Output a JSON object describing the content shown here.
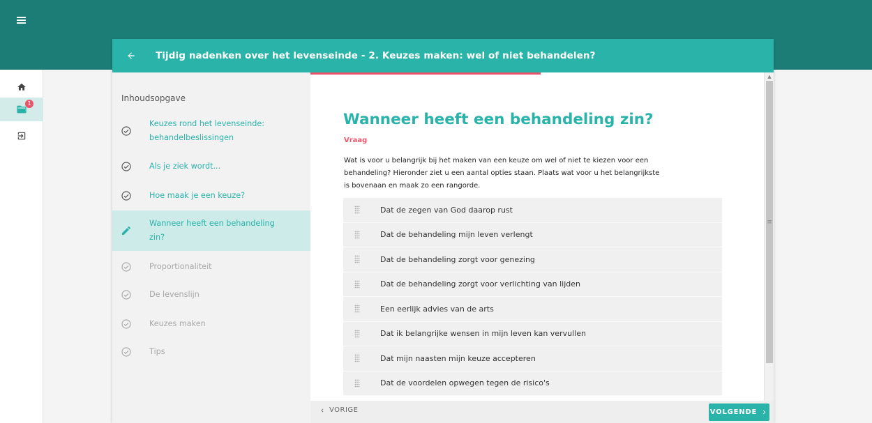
{
  "header": {
    "title": "Tijdig nadenken over het levenseinde - 2. Keuzes maken: wel of niet behandelen?"
  },
  "rail": {
    "badge_count": "1"
  },
  "toc": {
    "heading": "Inhoudsopgave",
    "items": [
      {
        "label": "Keuzes rond het levenseinde: behandelbeslissingen",
        "state": "done"
      },
      {
        "label": "Als je ziek wordt...",
        "state": "done"
      },
      {
        "label": "Hoe maak je een keuze?",
        "state": "done"
      },
      {
        "label": "Wanneer heeft een behandeling zin?",
        "state": "active"
      },
      {
        "label": "Proportionaliteit",
        "state": "locked"
      },
      {
        "label": "De levenslijn",
        "state": "locked"
      },
      {
        "label": "Keuzes maken",
        "state": "locked"
      },
      {
        "label": "Tips",
        "state": "locked"
      }
    ]
  },
  "content": {
    "title": "Wanneer heeft een behandeling zin?",
    "label": "Vraag",
    "question": "Wat is voor u belangrijk bij het maken van een keuze om wel of niet te kiezen voor een behandeling? Hieronder ziet u een aantal opties staan. Plaats wat voor u het belangrijkste is bovenaan en maak zo een rangorde.",
    "options": [
      "Dat de zegen van God daarop rust",
      "Dat de behandeling mijn leven verlengt",
      "Dat de behandeling zorgt voor genezing",
      "Dat de behandeling zorgt voor verlichting van lijden",
      "Een eerlijk advies van de arts",
      "Dat ik belangrijke wensen in mijn leven kan vervullen",
      "Dat mijn naasten mijn keuze accepteren",
      "Dat de voordelen opwegen tegen de risico's"
    ]
  },
  "footer": {
    "prev_label": "VORIGE",
    "next_label": "VOLGENDE"
  },
  "colors": {
    "topbar": "#1c7d76",
    "accent": "#2ab3a9",
    "pink": "#e9546b",
    "active_bg": "#cdebe8"
  }
}
